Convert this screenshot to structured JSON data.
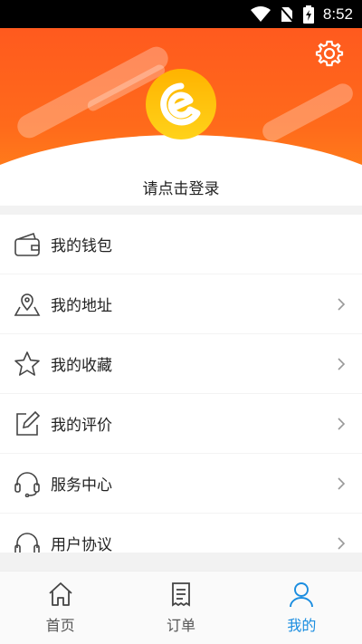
{
  "status_bar": {
    "time": "8:52"
  },
  "profile": {
    "login_prompt": "请点击登录"
  },
  "menu": {
    "items": [
      {
        "label": "我的钱包",
        "icon": "wallet-icon",
        "chevron": false
      },
      {
        "label": "我的地址",
        "icon": "location-icon",
        "chevron": true
      },
      {
        "label": "我的收藏",
        "icon": "star-icon",
        "chevron": true
      },
      {
        "label": "我的评价",
        "icon": "edit-icon",
        "chevron": true
      },
      {
        "label": "服务中心",
        "icon": "headset-icon",
        "chevron": true
      },
      {
        "label": "用户协议",
        "icon": "headphones-icon",
        "chevron": true
      }
    ]
  },
  "tabbar": {
    "tabs": [
      {
        "label": "首页",
        "icon": "home-icon",
        "active": false
      },
      {
        "label": "订单",
        "icon": "receipt-icon",
        "active": false
      },
      {
        "label": "我的",
        "icon": "user-icon",
        "active": true
      }
    ]
  },
  "colors": {
    "accent": "#ff5a1e",
    "active_tab": "#1a8de0"
  }
}
